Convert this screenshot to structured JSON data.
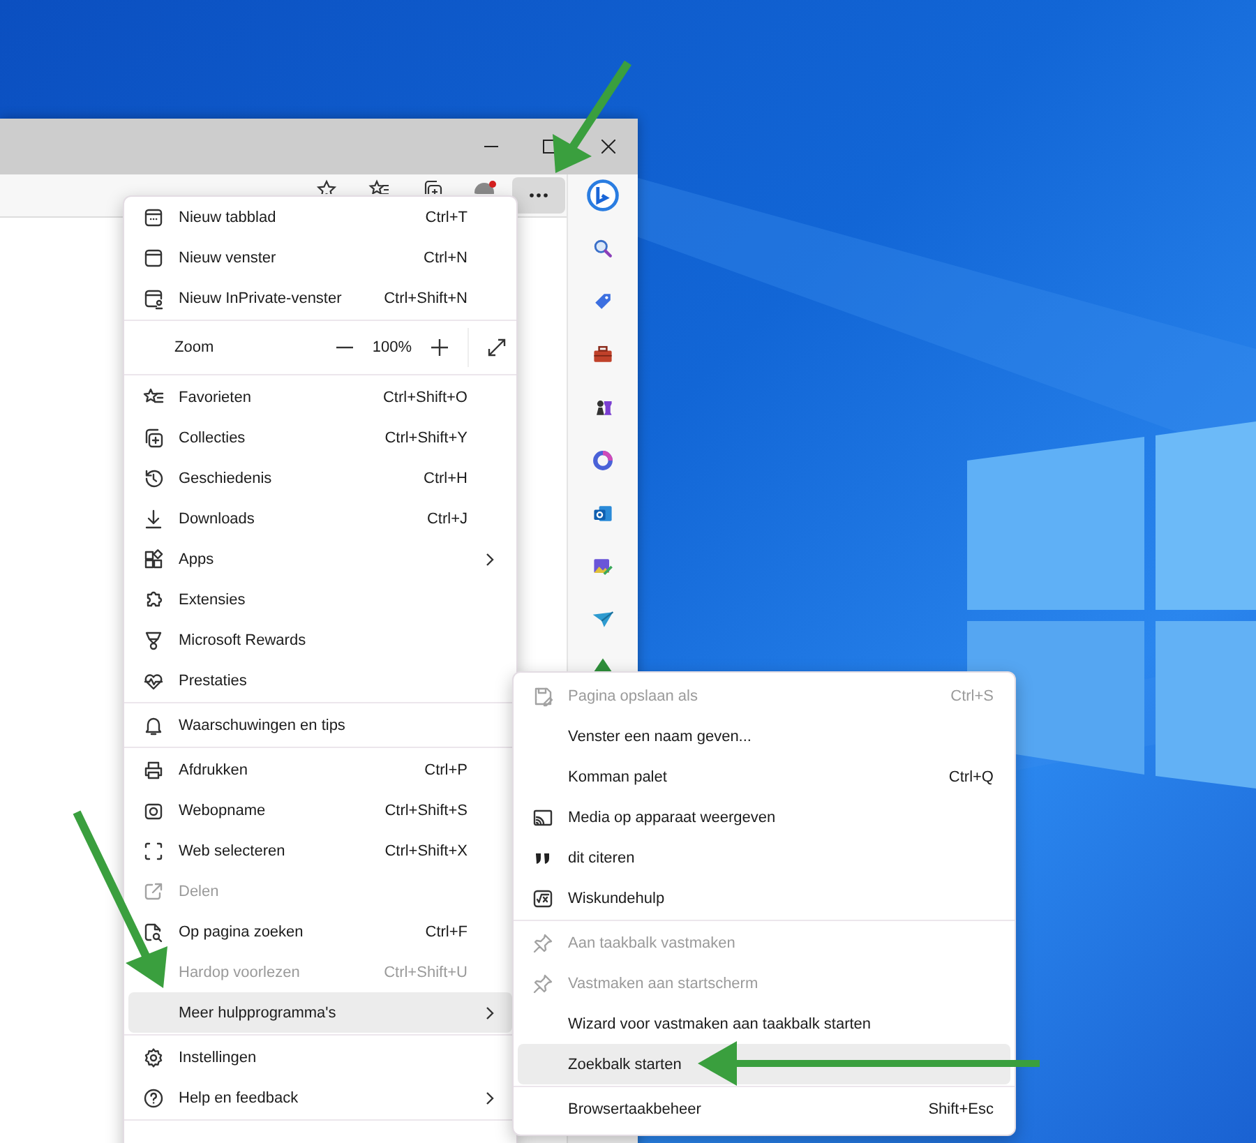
{
  "browser": {
    "toolbar": {
      "more_button": {
        "pressed": true
      }
    }
  },
  "main_menu": {
    "items": [
      {
        "kind": "command",
        "label": "Nieuw tabblad",
        "shortcut": "Ctrl+T",
        "disabled": false,
        "selected": false,
        "has_submenu": false
      },
      {
        "kind": "command",
        "label": "Nieuw venster",
        "shortcut": "Ctrl+N",
        "disabled": false,
        "selected": false,
        "has_submenu": false
      },
      {
        "kind": "command",
        "label": "Nieuw InPrivate-venster",
        "shortcut": "Ctrl+Shift+N",
        "disabled": false,
        "selected": false,
        "has_submenu": false
      },
      {
        "kind": "separator"
      },
      {
        "kind": "zoom",
        "label": "Zoom",
        "value": "100%"
      },
      {
        "kind": "separator"
      },
      {
        "kind": "command",
        "label": "Favorieten",
        "shortcut": "Ctrl+Shift+O",
        "disabled": false,
        "selected": false,
        "has_submenu": false
      },
      {
        "kind": "command",
        "label": "Collecties",
        "shortcut": "Ctrl+Shift+Y",
        "disabled": false,
        "selected": false,
        "has_submenu": false
      },
      {
        "kind": "command",
        "label": "Geschiedenis",
        "shortcut": "Ctrl+H",
        "disabled": false,
        "selected": false,
        "has_submenu": false
      },
      {
        "kind": "command",
        "label": "Downloads",
        "shortcut": "Ctrl+J",
        "disabled": false,
        "selected": false,
        "has_submenu": false
      },
      {
        "kind": "command",
        "label": "Apps",
        "disabled": false,
        "selected": false,
        "has_submenu": true
      },
      {
        "kind": "command",
        "label": "Extensies",
        "disabled": false,
        "selected": false,
        "has_submenu": false
      },
      {
        "kind": "command",
        "label": "Microsoft Rewards",
        "disabled": false,
        "selected": false,
        "has_submenu": false
      },
      {
        "kind": "command",
        "label": "Prestaties",
        "disabled": false,
        "selected": false,
        "has_submenu": false
      },
      {
        "kind": "separator"
      },
      {
        "kind": "command",
        "label": "Waarschuwingen en tips",
        "disabled": false,
        "selected": false,
        "has_submenu": false
      },
      {
        "kind": "separator"
      },
      {
        "kind": "command",
        "label": "Afdrukken",
        "shortcut": "Ctrl+P",
        "disabled": false,
        "selected": false,
        "has_submenu": false
      },
      {
        "kind": "command",
        "label": "Webopname",
        "shortcut": "Ctrl+Shift+S",
        "disabled": false,
        "selected": false,
        "has_submenu": false
      },
      {
        "kind": "command",
        "label": "Web selecteren",
        "shortcut": "Ctrl+Shift+X",
        "disabled": false,
        "selected": false,
        "has_submenu": false
      },
      {
        "kind": "command",
        "label": "Delen",
        "disabled": true,
        "selected": false,
        "has_submenu": false
      },
      {
        "kind": "command",
        "label": "Op pagina zoeken",
        "shortcut": "Ctrl+F",
        "disabled": false,
        "selected": false,
        "has_submenu": false
      },
      {
        "kind": "command",
        "label": "Hardop voorlezen",
        "shortcut": "Ctrl+Shift+U",
        "disabled": true,
        "selected": false,
        "has_submenu": false
      },
      {
        "kind": "command",
        "label": "Meer hulpprogramma's",
        "disabled": false,
        "selected": true,
        "has_submenu": true
      },
      {
        "kind": "separator"
      },
      {
        "kind": "command",
        "label": "Instellingen",
        "disabled": false,
        "selected": false,
        "has_submenu": false
      },
      {
        "kind": "command",
        "label": "Help en feedback",
        "disabled": false,
        "selected": false,
        "has_submenu": true
      },
      {
        "kind": "separator"
      }
    ]
  },
  "tools_submenu": {
    "items": [
      {
        "kind": "command",
        "label": "Pagina opslaan als",
        "shortcut": "Ctrl+S",
        "disabled": true,
        "selected": false,
        "has_submenu": false
      },
      {
        "kind": "command",
        "label": "Venster een naam geven...",
        "disabled": false,
        "selected": false,
        "has_submenu": false
      },
      {
        "kind": "command",
        "label": "Komman palet",
        "shortcut": "Ctrl+Q",
        "disabled": false,
        "selected": false,
        "has_submenu": false
      },
      {
        "kind": "command",
        "label": "Media op apparaat weergeven",
        "disabled": false,
        "selected": false,
        "has_submenu": false
      },
      {
        "kind": "command",
        "label": "dit citeren",
        "disabled": false,
        "selected": false,
        "has_submenu": false
      },
      {
        "kind": "command",
        "label": "Wiskundehulp",
        "disabled": false,
        "selected": false,
        "has_submenu": false
      },
      {
        "kind": "separator"
      },
      {
        "kind": "command",
        "label": "Aan taakbalk vastmaken",
        "disabled": true,
        "selected": false,
        "has_submenu": false
      },
      {
        "kind": "command",
        "label": "Vastmaken aan startscherm",
        "disabled": true,
        "selected": false,
        "has_submenu": false
      },
      {
        "kind": "command",
        "label": "Wizard voor vastmaken aan taakbalk starten",
        "disabled": false,
        "selected": false,
        "has_submenu": false
      },
      {
        "kind": "command",
        "label": "Zoekbalk starten",
        "disabled": false,
        "selected": true,
        "has_submenu": false
      },
      {
        "kind": "separator"
      },
      {
        "kind": "command",
        "label": "Browsertaakbeheer",
        "shortcut": "Shift+Esc",
        "disabled": false,
        "selected": false,
        "has_submenu": false
      }
    ]
  }
}
